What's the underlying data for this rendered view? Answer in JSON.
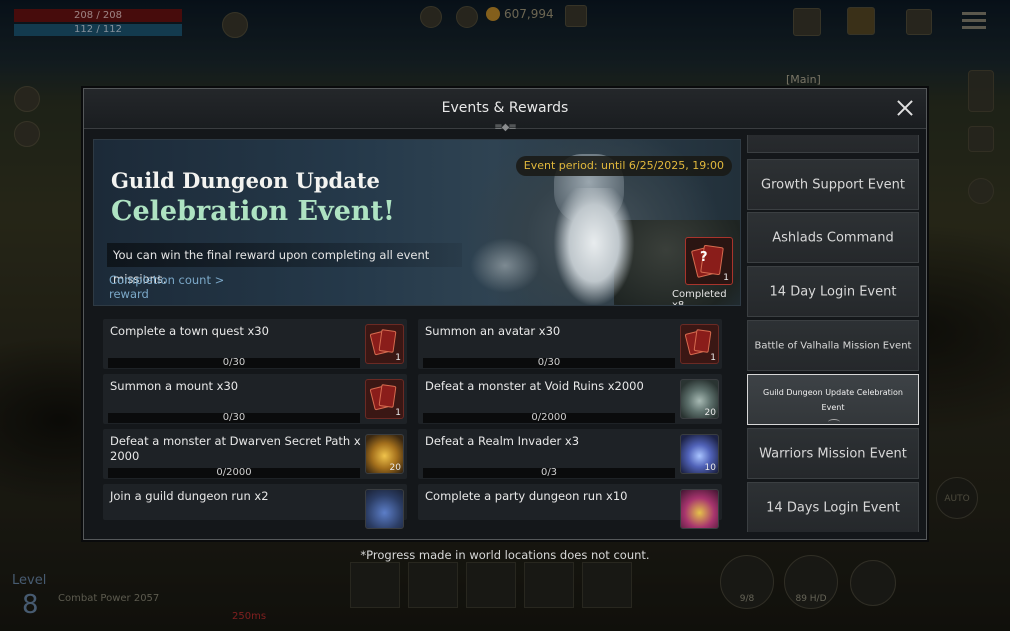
{
  "hud": {
    "hp": "208 / 208",
    "mp": "112 / 112",
    "gold": "607,994",
    "main_label": "[Main]",
    "level_label": "Level",
    "level": "8",
    "combat_power": "Combat Power 2057",
    "ping": "250ms",
    "slot_left_label": "9/8",
    "slot_right_label": "89 H/D",
    "auto_label": "AUTO"
  },
  "modal": {
    "title": "Events & Rewards",
    "close_icon": "close-icon",
    "banner": {
      "title_line1": "Guild Dungeon Update",
      "title_line2": "Celebration Event!",
      "event_period": "Event period: until 6/25/2025, 19:00",
      "description": "You can win the final reward upon completing all event missions.",
      "completion_link_line1": "Completion count >",
      "completion_link_line2": "reward",
      "reward_icon": "card-pack-icon",
      "reward_qty": "1",
      "reward_glyph": "?",
      "reward_completed": "Completed x8"
    },
    "missions": [
      {
        "label": "Complete a town quest x30",
        "progress": "0/30",
        "icon": "card-pack-icon",
        "qty": "1"
      },
      {
        "label": "Summon an avatar x30",
        "progress": "0/30",
        "icon": "card-pack-icon",
        "qty": "1"
      },
      {
        "label": "Summon a mount x30",
        "progress": "0/30",
        "icon": "card-pack-icon",
        "qty": "1"
      },
      {
        "label": "Defeat a monster at Void Ruins x2000",
        "progress": "0/2000",
        "icon": "stone-icon",
        "qty": "20"
      },
      {
        "label": "Defeat a monster at Dwarven Secret Path x 2000",
        "progress": "0/2000",
        "icon": "gem-icon",
        "qty": "20"
      },
      {
        "label": "Defeat a Realm Invader x3",
        "progress": "0/3",
        "icon": "crystal-icon",
        "qty": "10"
      },
      {
        "label": "Join a guild dungeon run x2",
        "progress": "",
        "icon": "orb-icon",
        "qty": ""
      },
      {
        "label": "Complete a party dungeon run x10",
        "progress": "",
        "icon": "chest-icon",
        "qty": ""
      }
    ],
    "sidebar": [
      {
        "label": "Growth Support Event"
      },
      {
        "label": "Ashlads Command"
      },
      {
        "label": "14 Day Login Event"
      },
      {
        "label": "Battle of Valhalla Mission Event"
      },
      {
        "label": "Guild Dungeon Update Celebration Event",
        "active": true
      },
      {
        "label": "Warriors Mission Event"
      },
      {
        "label": "14 Days Login Event"
      }
    ]
  },
  "footnote": "*Progress made in world locations does not count.",
  "colors": {
    "accent_gold": "#e1b83c",
    "title_green": "#aee3c2",
    "link_blue": "#7ba8c8",
    "active_border": "#d7d7d7"
  }
}
